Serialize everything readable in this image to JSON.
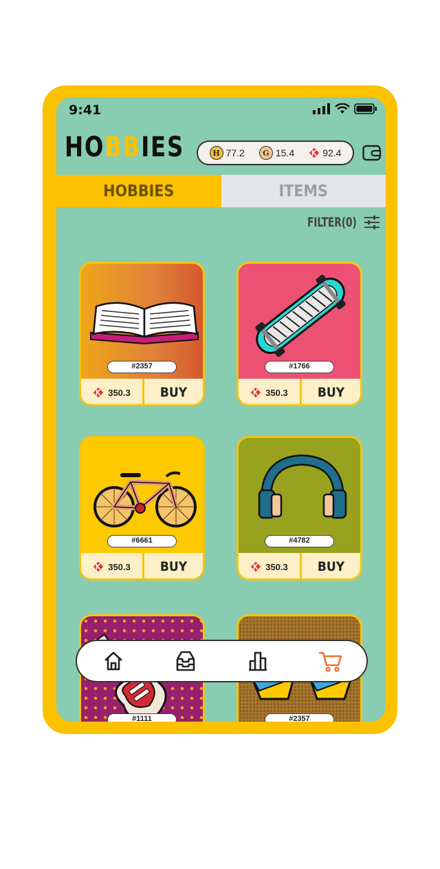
{
  "status": {
    "time": "9:41"
  },
  "header": {
    "logo_parts": [
      "HO",
      "BB",
      "IES"
    ],
    "currencies": [
      {
        "icon": "h-coin-icon",
        "letter": "H",
        "value": "77.2"
      },
      {
        "icon": "g-coin-icon",
        "letter": "G",
        "value": "15.4"
      },
      {
        "icon": "k-token-icon",
        "value": "92.4"
      }
    ]
  },
  "tabs": [
    {
      "label": "HOBBIES",
      "active": true
    },
    {
      "label": "ITEMS",
      "active": false
    }
  ],
  "filter": {
    "label": "FILTER(0)"
  },
  "cards": [
    {
      "art": "book",
      "id": "#2357",
      "price": "350.3",
      "buy": "BUY",
      "bg": "#E49A1E"
    },
    {
      "art": "skateboard",
      "id": "#1766",
      "price": "350.3",
      "buy": "BUY",
      "bg": "#EC5174"
    },
    {
      "art": "bicycle",
      "id": "#6661",
      "price": "350.3",
      "buy": "BUY",
      "bg": "#FDC900"
    },
    {
      "art": "headphones",
      "id": "#4782",
      "price": "350.3",
      "buy": "BUY",
      "bg": "#98A21F"
    },
    {
      "art": "guitar",
      "id": "#1111",
      "bg": "#97206E"
    },
    {
      "art": "sunglasses",
      "id": "#2357",
      "bg": "#A6762E"
    }
  ],
  "nav": [
    {
      "icon": "home-icon",
      "active": false
    },
    {
      "icon": "inbox-tray-icon",
      "active": false
    },
    {
      "icon": "leaderboard-icon",
      "active": false
    },
    {
      "icon": "cart-icon",
      "active": true
    }
  ],
  "colors": {
    "frame": "#FCC100",
    "screen": "#88CCB1",
    "accent": "#E9743A"
  }
}
